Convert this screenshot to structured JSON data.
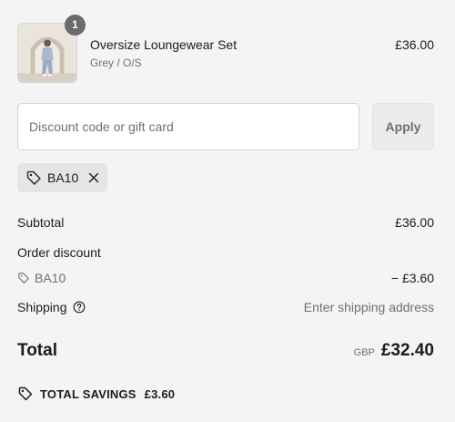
{
  "product": {
    "quantity": "1",
    "name": "Oversize Loungewear Set",
    "variant": "Grey / O/S",
    "price": "£36.00",
    "image_icon": "product-photo-woman-in-loungewear"
  },
  "discount": {
    "placeholder": "Discount code or gift card",
    "value": "",
    "apply_label": "Apply"
  },
  "applied_code": {
    "code": "BA10",
    "tag_icon": "tag-icon",
    "remove_icon": "close-icon"
  },
  "summary": {
    "subtotal_label": "Subtotal",
    "subtotal_value": "£36.00",
    "order_discount_label": "Order discount",
    "discount_code": "BA10",
    "discount_value": "− £3.60",
    "shipping_label": "Shipping",
    "shipping_value": "Enter shipping address",
    "total_label": "Total",
    "currency": "GBP",
    "total_value": "£32.40"
  },
  "savings": {
    "label": "TOTAL SAVINGS",
    "amount": "£3.60"
  },
  "colors": {
    "background": "#f4f4f4",
    "text": "#1c1c1c",
    "muted": "#707070",
    "badge": "#6b6b6b",
    "tag_background": "#e5e5e5",
    "button_background": "#ebebeb"
  }
}
